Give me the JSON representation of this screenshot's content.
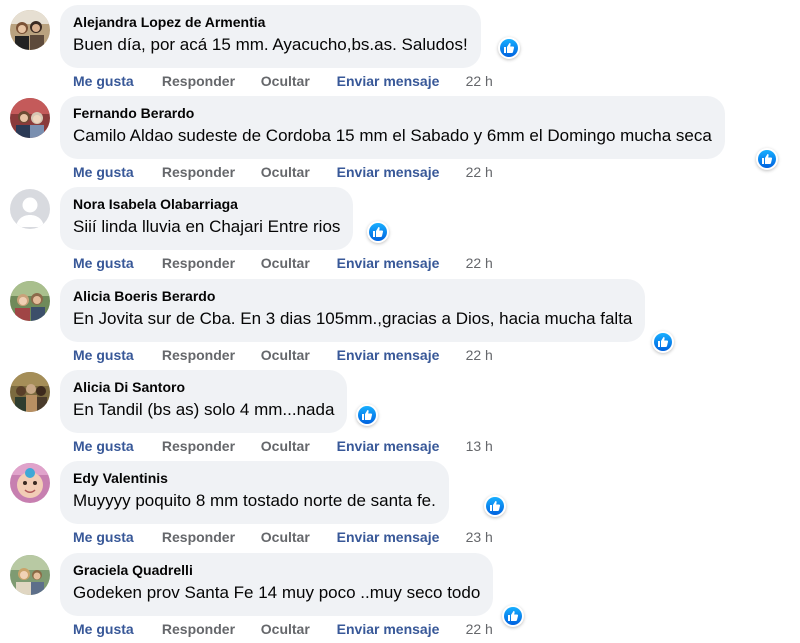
{
  "comments": [
    {
      "author": "Alejandra Lopez de Armentia",
      "text": "Buen día, por acá 15 mm. Ayacucho,bs.as. Saludos!",
      "time": "22 h"
    },
    {
      "author": "Fernando Berardo",
      "text": "Camilo Aldao sudeste de Cordoba 15 mm el Sabado y 6mm el Domingo mucha seca",
      "time": "22 h"
    },
    {
      "author": "Nora Isabela Olabarriaga",
      "text": "Siií linda lluvia en Chajari Entre rios",
      "time": "22 h"
    },
    {
      "author": "Alicia Boeris Berardo",
      "text": "En Jovita sur de Cba. En 3 dias 105mm.,gracias a Dios, hacia mucha falta",
      "time": "22 h"
    },
    {
      "author": "Alicia Di Santoro",
      "text": "En Tandil (bs as) solo 4 mm...nada",
      "time": "13 h"
    },
    {
      "author": "Edy Valentinis",
      "text": "Muyyyy poquito 8 mm tostado norte de santa fe.",
      "time": "23 h"
    },
    {
      "author": "Graciela Quadrelli",
      "text": "Godeken prov Santa Fe 14 muy poco ..muy seco todo",
      "time": "22 h"
    }
  ],
  "actions": {
    "like": "Me gusta",
    "reply": "Responder",
    "hide": "Ocultar",
    "message": "Enviar mensaje"
  },
  "colors": {
    "bubble": "#f0f2f5",
    "action_blue": "#385898",
    "action_gray": "#65676b",
    "like_blue": "#1877f2"
  },
  "icons": {
    "reaction": "like-thumb-icon",
    "default_avatar": "default-avatar-icon"
  }
}
